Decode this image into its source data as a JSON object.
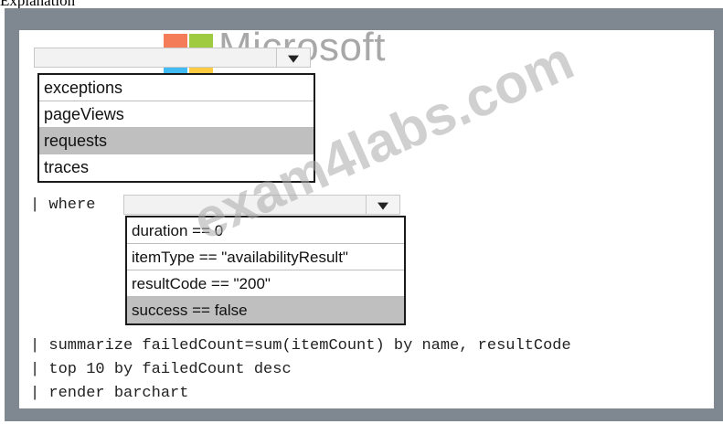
{
  "caption": "Explanation",
  "watermark": {
    "brand_text": "Microsoft",
    "site_text": "exam4labs.com",
    "logo_colors": [
      "#f25022",
      "#7fba00",
      "#00a4ef",
      "#ffb900"
    ]
  },
  "dropdown1": {
    "selected": "",
    "options": [
      "exceptions",
      "pageViews",
      "requests",
      "traces"
    ],
    "highlighted": "requests"
  },
  "query": {
    "where_prefix": "| where",
    "line1": "| summarize failedCount=sum(itemCount) by name, resultCode",
    "line2": "| top 10 by failedCount desc",
    "line3": "| render barchart"
  },
  "dropdown2": {
    "selected": "",
    "options": [
      "duration == 0",
      "itemType == \"availabilityResult\"",
      "resultCode == \"200\"",
      "success == false"
    ],
    "highlighted": "success == false"
  },
  "colors": {
    "frame": "#7f8791",
    "highlight": "#bfbfbf"
  }
}
